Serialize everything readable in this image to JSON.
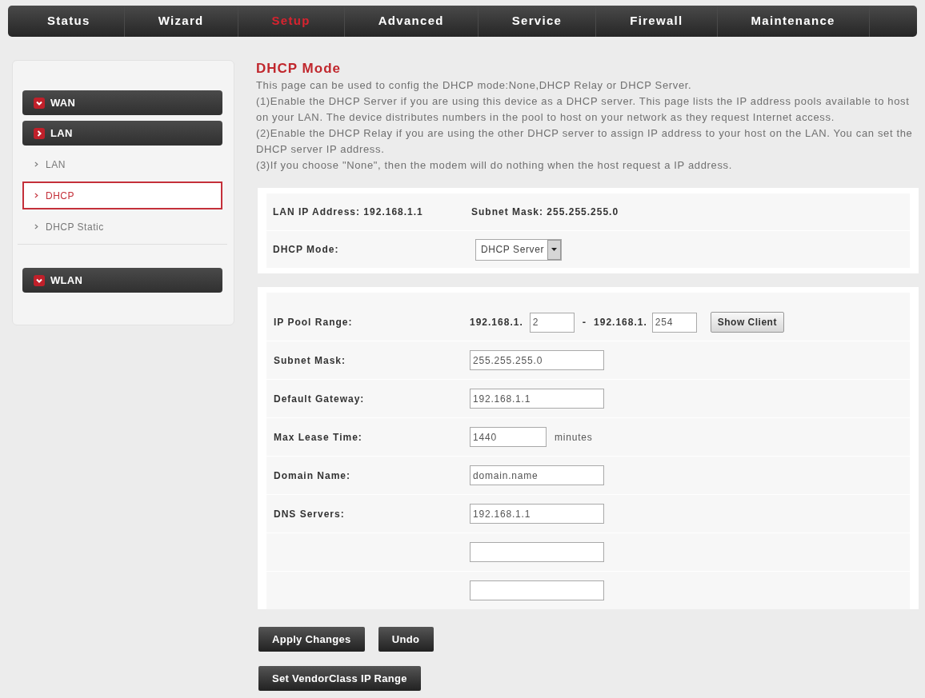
{
  "nav": [
    {
      "label": "Status",
      "selected": false
    },
    {
      "label": "Wizard",
      "selected": false
    },
    {
      "label": "Setup",
      "selected": true
    },
    {
      "label": "Advanced",
      "selected": false
    },
    {
      "label": "Service",
      "selected": false
    },
    {
      "label": "Firewall",
      "selected": false
    },
    {
      "label": "Maintenance",
      "selected": false
    }
  ],
  "sidebar": {
    "groups": [
      {
        "label": "WAN",
        "expanded": false
      },
      {
        "label": "LAN",
        "expanded": true,
        "children": [
          {
            "label": "LAN",
            "selected": false
          },
          {
            "label": "DHCP",
            "selected": true
          },
          {
            "label": "DHCP Static",
            "selected": false
          }
        ]
      },
      {
        "label": "WLAN",
        "expanded": false
      }
    ]
  },
  "page": {
    "title": "DHCP Mode",
    "intro": [
      "This page can be used to config the DHCP mode:None,DHCP Relay or DHCP Server.",
      "(1)Enable the DHCP Server if you are using this device as a DHCP server. This page lists the IP address pools available to host on your LAN. The device distributes numbers in the pool to host on your network as they request Internet access.",
      "(2)Enable the DHCP Relay if you are using the other DHCP server to assign IP address to your host on the LAN. You can set the DHCP server IP address.",
      "(3)If you choose \"None\", then the modem will do nothing when the host request a IP address."
    ]
  },
  "lan_info": {
    "ip_address": "LAN IP Address: 192.168.1.1",
    "subnet_mask": "Subnet Mask: 255.255.255.0",
    "mode_label": "DHCP Mode:",
    "mode_value": "DHCP Server"
  },
  "server_settings": {
    "rows": [
      {
        "kind": "range",
        "label": "IP Pool Range:",
        "start_prefix": "192.168.1.",
        "start": "2",
        "dash": "-",
        "end_prefix": "192.168.1.",
        "end": "254",
        "button": "Show Client"
      },
      {
        "kind": "text",
        "label": "Subnet Mask:",
        "value": "255.255.255.0"
      },
      {
        "kind": "text",
        "label": "Default Gateway:",
        "value": "192.168.1.1"
      },
      {
        "kind": "unit",
        "label": "Max Lease Time:",
        "value": "1440",
        "unit": "minutes"
      },
      {
        "kind": "text",
        "label": "Domain Name:",
        "value": "domain.name"
      },
      {
        "kind": "text",
        "label": "DNS Servers:",
        "value": "192.168.1.1"
      },
      {
        "kind": "text"
      },
      {
        "kind": "text"
      }
    ]
  },
  "buttons": [
    {
      "label": "Apply Changes"
    },
    {
      "label": "Undo"
    }
  ],
  "vendor_button": {
    "label": "Set VendorClass IP Range"
  }
}
